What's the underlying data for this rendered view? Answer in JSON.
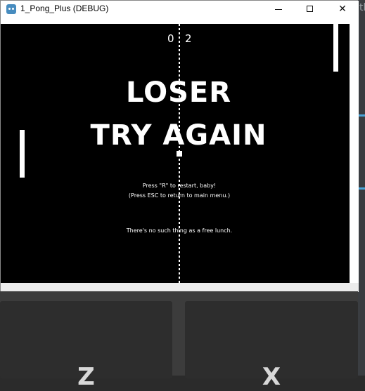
{
  "window": {
    "title": "1_Pong_Plus (DEBUG)",
    "controls": {
      "minimize": "",
      "maximize": "",
      "close": "✕"
    }
  },
  "game": {
    "score_left": "0",
    "score_right": "2",
    "headline_1": "LOSER",
    "headline_2": "TRY AGAIN",
    "restart_hint": "Press \"R\" to restart, baby!",
    "esc_hint": "(Press ESC to return to main menu.)",
    "tagline": "There's no such thing as a free lunch."
  },
  "keys": {
    "left_key": "Z",
    "right_key": "X"
  },
  "background": {
    "partial_glyph": "tl",
    "accent_color": "#4aa3d8"
  }
}
